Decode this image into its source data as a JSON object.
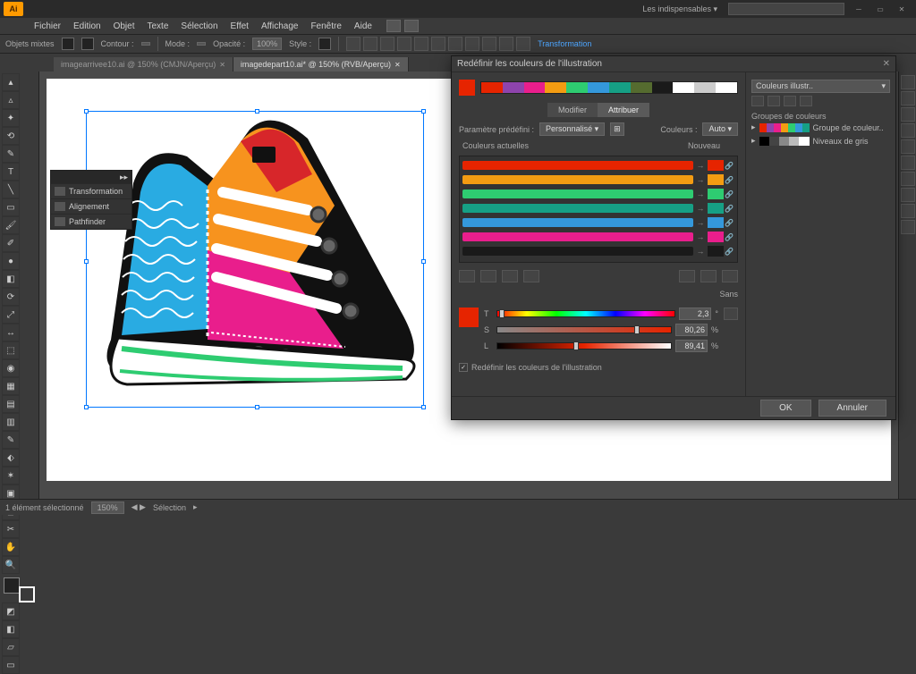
{
  "app": {
    "logo": "Ai",
    "workspace": "Les indispensables"
  },
  "menu": [
    "Fichier",
    "Edition",
    "Objet",
    "Texte",
    "Sélection",
    "Effet",
    "Affichage",
    "Fenêtre",
    "Aide"
  ],
  "ctrl": {
    "objets": "Objets mixtes",
    "contour": "Contour :",
    "mode": "Mode :",
    "opacite": "Opacité :",
    "opaciteVal": "100%",
    "style": "Style :",
    "transform": "Transformation"
  },
  "tabs": [
    {
      "name": "imagearrivee10.ai @ 150% (CMJN/Aperçu)",
      "active": false
    },
    {
      "name": "imagedepart10.ai* @ 150% (RVB/Aperçu)",
      "active": true
    }
  ],
  "subpanel": [
    "Transformation",
    "Alignement",
    "Pathfinder"
  ],
  "dialog": {
    "title": "Redéfinir les couleurs de l'illustration",
    "colorbtn": "Couleurs illustr..",
    "tab1": "Modifier",
    "tab2": "Attribuer",
    "presetLbl": "Paramètre prédéfini :",
    "presetVal": "Personnalisé",
    "couleursLbl": "Couleurs :",
    "couleursVal": "Auto",
    "curLbl": "Couleurs actuelles",
    "newLbl": "Nouveau",
    "tsl": {
      "t": "T",
      "s": "S",
      "l": "L",
      "tv": "2,3",
      "sv": "80,26",
      "lv": "89,41",
      "unit": "%",
      "deg": "°",
      "sans": "Sans"
    },
    "chk": "Redéfinir les couleurs de l'illustration",
    "groupsHdr": "Groupes de couleurs",
    "grp1": "Groupe de couleur..",
    "grp2": "Niveaux de gris",
    "ok": "OK",
    "cancel": "Annuler"
  },
  "colors": {
    "strip": [
      "#e62400",
      "#8e44ad",
      "#e91e8c",
      "#f39c12",
      "#2ecc71",
      "#3498db",
      "#16a085",
      "#556b2f",
      "#1a1a1a",
      "#ffffff",
      "#cccccc",
      "#ffffff"
    ],
    "rows": [
      {
        "c": "#e62400"
      },
      {
        "c": "#f39c12"
      },
      {
        "c": "#2ecc71"
      },
      {
        "c": "#16a085"
      },
      {
        "c": "#3498db"
      },
      {
        "c": "#e91e8c"
      },
      {
        "c": "#1a1a1a"
      }
    ],
    "grp1": [
      "#e62400",
      "#8e44ad",
      "#e91e8c",
      "#f39c12",
      "#2ecc71",
      "#3498db",
      "#16a085"
    ],
    "grp2": [
      "#000",
      "#444",
      "#888",
      "#bbb",
      "#fff"
    ]
  },
  "status": {
    "zoom": "150%",
    "sel": "Sélection",
    "info": "1 élément sélectionné"
  }
}
